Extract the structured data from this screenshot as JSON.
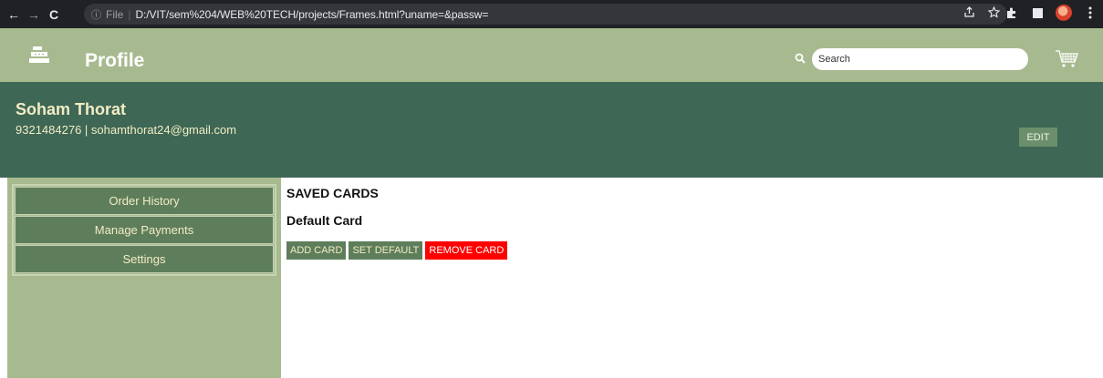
{
  "browser": {
    "nav": {
      "back": "←",
      "forward": "→",
      "reload": "C"
    },
    "omnibox": {
      "info": "ⓘ",
      "scheme_label": "File",
      "separator": "|",
      "url": "D:/VIT/sem%204/WEB%20TECH/projects/Frames.html?uname=&passw="
    }
  },
  "header": {
    "title": "Profile",
    "search": {
      "placeholder": "Search"
    }
  },
  "banner": {
    "name": "Soham Thorat",
    "contact": "9321484276 | sohamthorat24@gmail.com",
    "edit_label": "EDIT"
  },
  "sidebar": {
    "items": [
      {
        "label": "Order History"
      },
      {
        "label": "Manage Payments"
      },
      {
        "label": "Settings"
      }
    ]
  },
  "main": {
    "section_title": "SAVED CARDS",
    "card_title": "Default Card",
    "actions": {
      "add": "ADD CARD",
      "set_default": "SET DEFAULT",
      "remove": "REMOVE CARD"
    }
  },
  "colors": {
    "header_bg": "#a7ba8f",
    "banner_bg": "#3e6755",
    "button_bg": "#5e7e5b",
    "danger": "#ff0000",
    "cream_text": "#f2ecc5"
  }
}
